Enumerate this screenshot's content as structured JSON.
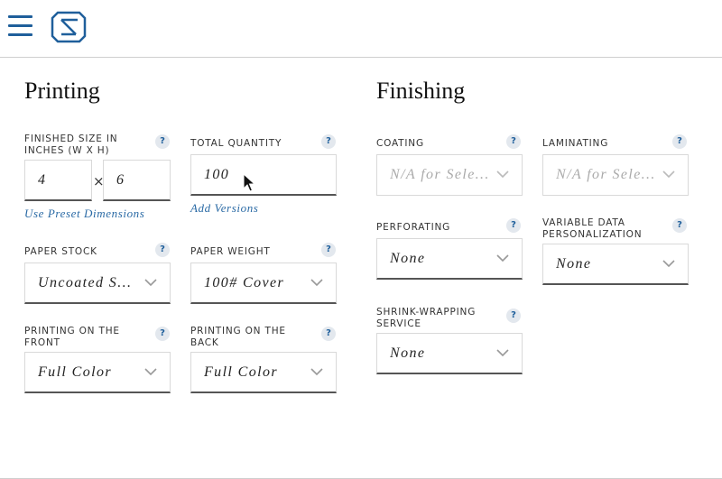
{
  "brand": {
    "logo_icon": "s-logo-icon",
    "accent_color": "#1f5f9b"
  },
  "printing": {
    "title": "Printing",
    "finished_size": {
      "label": "FINISHED SIZE IN INCHES (W X H)",
      "width": "4",
      "height": "6",
      "times": "×",
      "preset_link": "Use Preset Dimensions"
    },
    "total_quantity": {
      "label": "TOTAL QUANTITY",
      "value": "100",
      "versions_link": "Add Versions"
    },
    "paper_stock": {
      "label": "PAPER STOCK",
      "value": "Uncoated S..."
    },
    "paper_weight": {
      "label": "PAPER WEIGHT",
      "value": "100# Cover"
    },
    "printing_front": {
      "label": "PRINTING ON THE FRONT",
      "value": "Full Color"
    },
    "printing_back": {
      "label": "PRINTING ON THE BACK",
      "value": "Full Color"
    }
  },
  "finishing": {
    "title": "Finishing",
    "coating": {
      "label": "COATING",
      "value": "N/A for Sele..."
    },
    "laminating": {
      "label": "LAMINATING",
      "value": "N/A for Sele..."
    },
    "perforating": {
      "label": "PERFORATING",
      "value": "None"
    },
    "variable_data": {
      "label": "VARIABLE DATA PERSONALIZATION",
      "value": "None"
    },
    "shrink_wrapping": {
      "label": "SHRINK-WRAPPING SERVICE",
      "value": "None"
    }
  },
  "help_symbol": "?"
}
